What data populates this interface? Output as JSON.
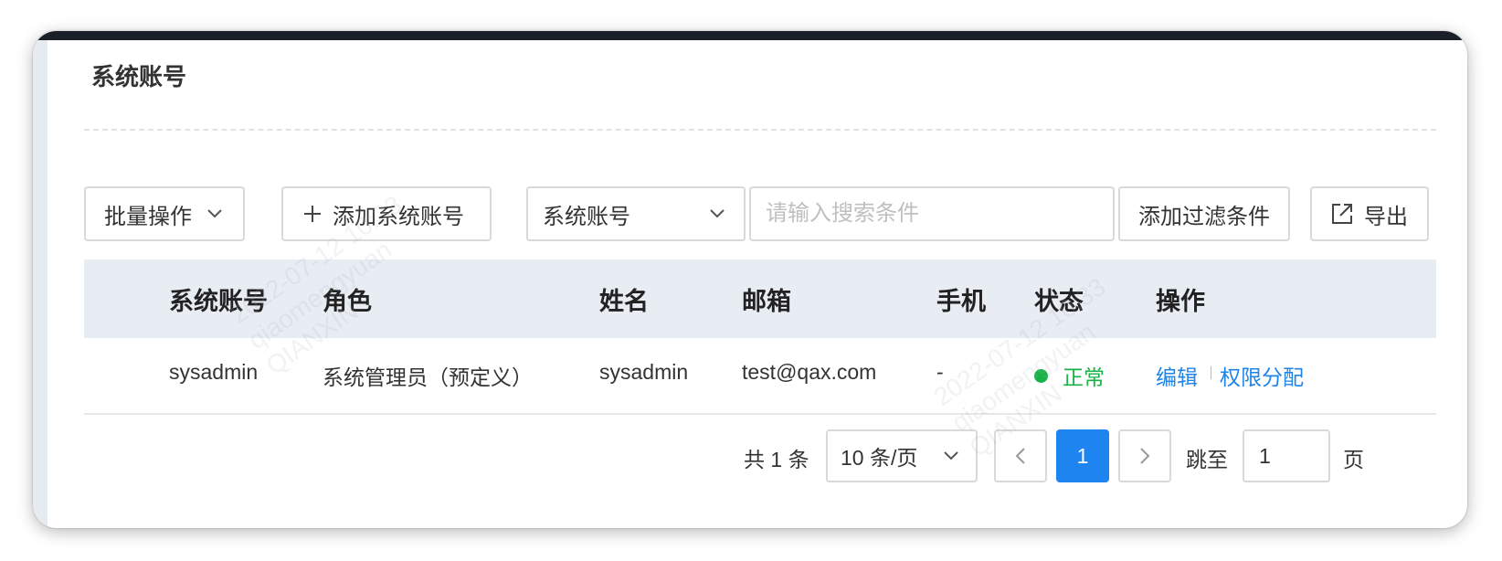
{
  "page": {
    "title": "系统账号"
  },
  "toolbar": {
    "batch_label": "批量操作",
    "add_label": "添加系统账号",
    "field_select_value": "系统账号",
    "search_placeholder": "请输入搜索条件",
    "filter_label": "添加过滤条件",
    "export_label": "导出"
  },
  "table": {
    "columns": [
      "系统账号",
      "角色",
      "姓名",
      "邮箱",
      "手机",
      "状态",
      "操作"
    ],
    "rows": [
      {
        "account": "sysadmin",
        "role": "系统管理员（预定义）",
        "name": "sysadmin",
        "email": "test@qax.com",
        "phone": "-",
        "status": "正常",
        "actions": [
          "编辑",
          "权限分配"
        ]
      }
    ]
  },
  "pagination": {
    "total_text": "共 1 条",
    "page_size": "10 条/页",
    "current_page": "1",
    "jump_label": "跳至",
    "jump_value": "1",
    "page_suffix": "页"
  },
  "watermark": {
    "date_text": "2022-07-12 10:33",
    "user_text": "qiaomengyuan",
    "org_text": "QIANXIN"
  },
  "colors": {
    "accent": "#1e84f0",
    "link": "#1e84e8",
    "status_ok": "#17b346",
    "table_header_bg": "#e8ecf3"
  },
  "icons": {
    "batch": "chevron-down-icon",
    "add": "plus-icon",
    "field_select": "chevron-down-icon",
    "export": "external-link-icon",
    "prev": "chevron-left-icon",
    "next": "chevron-right-icon",
    "page_size": "chevron-down-icon"
  }
}
